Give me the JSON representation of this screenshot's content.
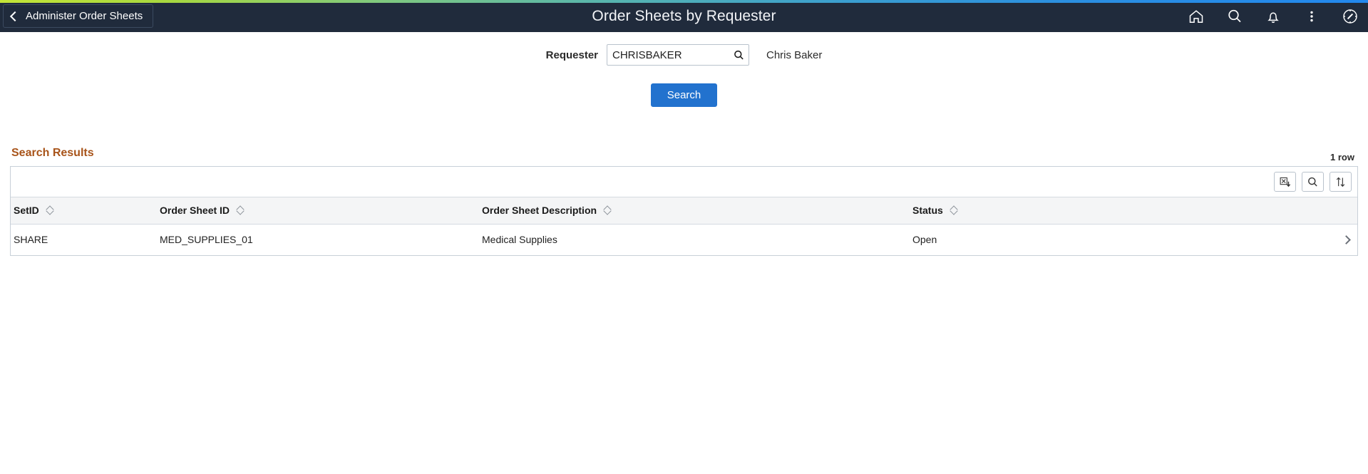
{
  "header": {
    "back_label": "Administer Order Sheets",
    "title": "Order Sheets by Requester",
    "icons": [
      {
        "name": "home-icon",
        "label": "Home"
      },
      {
        "name": "search-icon",
        "label": "Search"
      },
      {
        "name": "bell-icon",
        "label": "Notifications"
      },
      {
        "name": "more-vertical-icon",
        "label": "Actions"
      },
      {
        "name": "compass-icon",
        "label": "NavBar"
      }
    ],
    "accent_gradient_start": "#c4e538",
    "accent_gradient_end": "#2288ee",
    "bar_color": "#202b3c"
  },
  "criteria": {
    "requester_label": "Requester",
    "requester_value": "CHRISBAKER",
    "requester_placeholder": "",
    "lookup_icon": "search-icon",
    "requester_description": "Chris Baker",
    "search_button_label": "Search",
    "search_button_color": "#2272ce"
  },
  "results": {
    "title": "Search Results",
    "title_color": "#a8541a",
    "row_count": "1 row",
    "toolbar": [
      {
        "name": "download-excel-icon",
        "label": "Download to Excel"
      },
      {
        "name": "find-icon",
        "label": "Find"
      },
      {
        "name": "sort-icon",
        "label": "Sort"
      }
    ],
    "columns": [
      {
        "label": "SetID",
        "sortable": true
      },
      {
        "label": "Order Sheet ID",
        "sortable": true
      },
      {
        "label": "Order Sheet Description",
        "sortable": true
      },
      {
        "label": "Status",
        "sortable": true
      }
    ],
    "rows": [
      {
        "setid": "SHARE",
        "order_sheet_id": "MED_SUPPLIES_01",
        "order_sheet_description": "Medical Supplies",
        "status": "Open",
        "drill_icon": "chevron-right-icon"
      }
    ]
  }
}
